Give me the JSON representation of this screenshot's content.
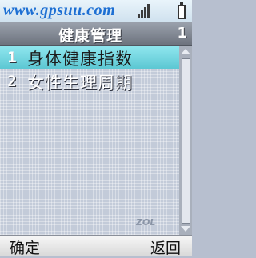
{
  "watermark": {
    "site": "www.gpsuu.com",
    "corner": "ZOL"
  },
  "header": {
    "title": "健康管理",
    "page_number": "1"
  },
  "menu": {
    "items": [
      {
        "number": "1",
        "label": "身体健康指数",
        "selected": true
      },
      {
        "number": "2",
        "label": "女性生理周期",
        "selected": false
      }
    ]
  },
  "softkeys": {
    "left": "确定",
    "right": "返回"
  },
  "colors": {
    "selection": "#6fd6e0",
    "title_bar": "#7b818c",
    "background": "#c3cbd9"
  }
}
